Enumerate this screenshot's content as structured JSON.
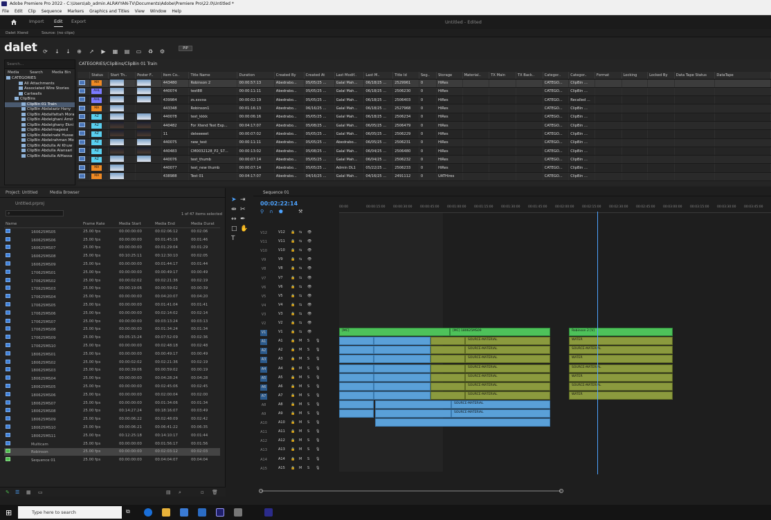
{
  "window": {
    "title": "Adobe Premiere Pro 2022 - C:\\Users\\ab_admin.ALRAYYAN-TV\\Documents\\Adobe\\Premiere Pro\\22.0\\Untitled *"
  },
  "menu": [
    "File",
    "Edit",
    "Clip",
    "Sequence",
    "Markers",
    "Graphics and Titles",
    "View",
    "Window",
    "Help"
  ],
  "workspace": {
    "tabs": [
      "Import",
      "Edit",
      "Export"
    ],
    "active": "Edit",
    "title": "Untitled - Edited"
  },
  "dalet": {
    "tabs": [
      "Dalet Xtend",
      "Source: (no clips)"
    ],
    "logo": "dalet",
    "toolbar_button": "PIP",
    "tree": {
      "search_placeholder": "Search...",
      "tabs": [
        "Media",
        "Search",
        "Media Bin"
      ],
      "items": [
        "CATEGORIES",
        "All Attachments",
        "Associated Wire Stories",
        "Cartwalls",
        "ClipBins",
        "ClipBin 01 Train",
        "ClipBin Abdalaziz Hany",
        "ClipBin Abdalfattah Mora",
        "ClipBin Abdelghani Amir",
        "ClipBin Abdelghany Ekni",
        "ClipBin Abdelmageed",
        "ClipBin Abdelnabi Husse",
        "ClipBin Abdelrahman Mo",
        "ClipBin Abdulla Al Khuw",
        "ClipBin Abdulla Alansari",
        "ClipBin Abdulla AlHassa"
      ]
    },
    "grid": {
      "path": "CATEGORIES/ClipBins/ClipBin 01 Train",
      "columns": [
        "",
        "Status",
        "Start Th..",
        "Poster F..",
        "Item Co..",
        "Title Name",
        "Duration",
        "Created By",
        "Created At",
        "Last Modif..",
        "Last M..",
        "Title Id",
        "Seg..",
        "Storage",
        "Material..",
        "TX Main",
        "TX Back..",
        "Categor..",
        "Categor..",
        "Format",
        "Locking",
        "Locked By",
        "Data Tape Status",
        "DataTape"
      ],
      "rows": [
        {
          "status": "MA",
          "id": "443480",
          "title": "Robinson 2",
          "dur": "00:00:57:13",
          "by": "Abedrabo...",
          "at": "05/05/25 ...",
          "mod": "Galal Mah...",
          "lm": "06/18/25 ...",
          "tid": "2529961",
          "seg": "0",
          "st": "HiRes",
          "c1": "CATEGO...",
          "c2": "ClipBin ..."
        },
        {
          "status": "AHL",
          "id": "440074",
          "title": "test88",
          "dur": "00:00:11:11",
          "by": "Abedrabo...",
          "at": "05/05/25 ...",
          "mod": "Galal Mah...",
          "lm": "06/18/25 ...",
          "tid": "2506230",
          "seg": "0",
          "st": "HiRes",
          "c1": "CATEGO...",
          "c2": "ClipBin ..."
        },
        {
          "status": "AHL",
          "id": "439984",
          "title": "zs.xxvxa",
          "dur": "00:00:02:19",
          "by": "Abedrabo...",
          "at": "05/05/25 ...",
          "mod": "Galal Mah...",
          "lm": "06/18/25 ...",
          "tid": "2506403",
          "seg": "0",
          "st": "HiRes",
          "c1": "CATEGO...",
          "c2": "Recalled ..."
        },
        {
          "status": "MA",
          "id": "443348",
          "title": "Robinson1",
          "dur": "00:01:16:13",
          "by": "Abedrabo...",
          "at": "06/16/25 ...",
          "mod": "Galal Mah...",
          "lm": "06/18/25 ...",
          "tid": "2527968",
          "seg": "0",
          "st": "HiRes",
          "c1": "CATEGO...",
          "c2": "ClipBin ..."
        },
        {
          "status": "AZ",
          "id": "440078",
          "title": "test_kkkk",
          "dur": "00:00:06:16",
          "by": "Abedrabo...",
          "at": "05/05/25 ...",
          "mod": "Galal Mah...",
          "lm": "06/18/25 ...",
          "tid": "2506234",
          "seg": "0",
          "st": "HiRes",
          "c1": "CATEGO...",
          "c2": "ClipBin ..."
        },
        {
          "status": "AZ",
          "id": "440482",
          "title": "For Xtend Test Exp...",
          "dur": "00:04:17:07",
          "by": "Abedrabo...",
          "at": "05/08/25 ...",
          "mod": "Galal Mah...",
          "lm": "06/05/25 ...",
          "tid": "2506479",
          "seg": "0",
          "st": "HiRes",
          "c1": "CATEGO...",
          "c2": "ClipBin ..."
        },
        {
          "status": "AZ",
          "id": "11",
          "title": "deleeeeet",
          "dur": "00:00:07:02",
          "by": "Abedrabo...",
          "at": "05/05/25 ...",
          "mod": "Galal Mah...",
          "lm": "06/05/25 ...",
          "tid": "2506229",
          "seg": "0",
          "st": "HiRes",
          "c1": "CATEGO...",
          "c2": "ClipBin ..."
        },
        {
          "status": "AZ",
          "id": "440075",
          "title": "new_test",
          "dur": "00:00:11:11",
          "by": "Abedrabo...",
          "at": "05/05/25 ...",
          "mod": "Abedrabo...",
          "lm": "06/05/25 ...",
          "tid": "2506231",
          "seg": "0",
          "st": "HiRes",
          "c1": "CATEGO...",
          "c2": "ClipBin ..."
        },
        {
          "status": "AZ",
          "id": "440483",
          "title": "CM0032128_P2_S7...",
          "dur": "00:00:13:02",
          "by": "Abedrabo...",
          "at": "05/08/25 ...",
          "mod": "Galal Mah...",
          "lm": "06/04/25 ...",
          "tid": "2506480",
          "seg": "0",
          "st": "HiRes",
          "c1": "CATEGO...",
          "c2": "ClipBin ..."
        },
        {
          "status": "AZ",
          "id": "440076",
          "title": "test_thumb",
          "dur": "00:00:07:14",
          "by": "Abedrabo...",
          "at": "05/05/25 ...",
          "mod": "Galal Mah...",
          "lm": "06/04/25 ...",
          "tid": "2506232",
          "seg": "0",
          "st": "HiRes",
          "c1": "CATEGO...",
          "c2": "ClipBin ..."
        },
        {
          "status": "MA",
          "id": "440077",
          "title": "test_new thumb",
          "dur": "00:00:07:14",
          "by": "Abedrabo...",
          "at": "05/05/25 ...",
          "mod": "Admin DL1",
          "lm": "05/22/25 ...",
          "tid": "2506233",
          "seg": "0",
          "st": "HiRes",
          "c1": "CATEGO...",
          "c2": "ClipBin ..."
        },
        {
          "status": "MA",
          "id": "438988",
          "title": "Test 01",
          "dur": "00:04:17:07",
          "by": "Abedrabo...",
          "at": "04/16/25 ...",
          "mod": "Galal Mah...",
          "lm": "04/16/25 ...",
          "tid": "2491112",
          "seg": "0",
          "st": "UATHires",
          "c1": "CATEGO...",
          "c2": "ClipBin ..."
        }
      ]
    }
  },
  "project": {
    "tabs": [
      "Project: Untitled",
      "Media Browser"
    ],
    "name": "Untitled.prproj",
    "count": "1 of 47 items selected",
    "columns": [
      "Name",
      "Frame Rate",
      "Media Start",
      "Media End",
      "Media Durat"
    ],
    "rows": [
      {
        "n": "160625MS05",
        "fr": "25.00 fps",
        "s": "00:00:00:00",
        "e": "00:02:06:12",
        "d": "00:02:06"
      },
      {
        "n": "160625MS06",
        "fr": "25.00 fps",
        "s": "00:00:00:00",
        "e": "00:01:45:16",
        "d": "00:01:46"
      },
      {
        "n": "160625MS07",
        "fr": "25.00 fps",
        "s": "00:00:00:00",
        "e": "00:01:29:04",
        "d": "00:01:29"
      },
      {
        "n": "160625MS08",
        "fr": "25.00 fps",
        "s": "00:10:25:11",
        "e": "00:12:30:10",
        "d": "00:02:05"
      },
      {
        "n": "160625MS09",
        "fr": "25.00 fps",
        "s": "00:00:00:00",
        "e": "00:01:44:17",
        "d": "00:01:44"
      },
      {
        "n": "170625MS01",
        "fr": "25.00 fps",
        "s": "00:00:00:00",
        "e": "00:00:49:17",
        "d": "00:00:49"
      },
      {
        "n": "170625MS02",
        "fr": "25.00 fps",
        "s": "00:00:02:02",
        "e": "00:02:21:36",
        "d": "00:02:19"
      },
      {
        "n": "170625MS03",
        "fr": "25.00 fps",
        "s": "00:00:19:06",
        "e": "00:00:59:02",
        "d": "00:00:39"
      },
      {
        "n": "170625MS04",
        "fr": "25.00 fps",
        "s": "00:00:00:00",
        "e": "00:04:20:07",
        "d": "00:04:20"
      },
      {
        "n": "170625MS05",
        "fr": "25.00 fps",
        "s": "00:00:00:00",
        "e": "00:01:41:04",
        "d": "00:01:41"
      },
      {
        "n": "170625MS06",
        "fr": "25.00 fps",
        "s": "00:00:00:00",
        "e": "00:02:14:02",
        "d": "00:02:14"
      },
      {
        "n": "170625MS07",
        "fr": "25.00 fps",
        "s": "00:00:00:00",
        "e": "00:03:13:24",
        "d": "00:03:13"
      },
      {
        "n": "170625MS08",
        "fr": "25.00 fps",
        "s": "00:00:00:00",
        "e": "00:01:34:24",
        "d": "00:01:34"
      },
      {
        "n": "170625MS09",
        "fr": "25.00 fps",
        "s": "00:05:15:24",
        "e": "00:07:52:09",
        "d": "00:02:36"
      },
      {
        "n": "170625MS10",
        "fr": "25.00 fps",
        "s": "00:00:00:00",
        "e": "00:02:48:18",
        "d": "00:02:48"
      },
      {
        "n": "180625MS01",
        "fr": "25.00 fps",
        "s": "00:00:00:00",
        "e": "00:00:49:17",
        "d": "00:00:49"
      },
      {
        "n": "180625MS02",
        "fr": "25.00 fps",
        "s": "00:00:02:02",
        "e": "00:02:21:36",
        "d": "00:02:19"
      },
      {
        "n": "180625MS03",
        "fr": "25.00 fps",
        "s": "00:00:39:06",
        "e": "00:00:59:02",
        "d": "00:00:19"
      },
      {
        "n": "180625MS04",
        "fr": "25.00 fps",
        "s": "00:00:00:00",
        "e": "00:04:28:24",
        "d": "00:04:28"
      },
      {
        "n": "180625MS05",
        "fr": "25.00 fps",
        "s": "00:00:00:00",
        "e": "00:02:45:06",
        "d": "00:02:45"
      },
      {
        "n": "180625MS06",
        "fr": "25.00 fps",
        "s": "00:00:00:00",
        "e": "00:02:00:04",
        "d": "00:02:00"
      },
      {
        "n": "180625MS07",
        "fr": "25.00 fps",
        "s": "00:00:00:00",
        "e": "00:01:34:06",
        "d": "00:01:34"
      },
      {
        "n": "180625MS08",
        "fr": "25.00 fps",
        "s": "00:14:27:24",
        "e": "00:18:16:07",
        "d": "00:03:49"
      },
      {
        "n": "180625MS09",
        "fr": "25.00 fps",
        "s": "00:00:06:22",
        "e": "00:02:48:09",
        "d": "00:02:42"
      },
      {
        "n": "180625MS10",
        "fr": "25.00 fps",
        "s": "00:00:06:21",
        "e": "00:06:41:22",
        "d": "00:06:35"
      },
      {
        "n": "180625MS11",
        "fr": "25.00 fps",
        "s": "00:12:25:18",
        "e": "00:14:10:17",
        "d": "00:01:44"
      },
      {
        "n": "Multicam",
        "fr": "25.00 fps",
        "s": "00:00:00:00",
        "e": "00:01:56:17",
        "d": "00:01:56"
      },
      {
        "n": "Robinson",
        "fr": "25.00 fps",
        "s": "00:00:00:00",
        "e": "00:02:03:12",
        "d": "00:02:03"
      },
      {
        "n": "Sequence 01",
        "fr": "25.00 fps",
        "s": "00:00:00:00",
        "e": "00:04:04:07",
        "d": "00:04:04"
      }
    ]
  },
  "sequence": {
    "tab": "Sequence 01",
    "timecode": "00:02:22:14",
    "ruler": [
      "00:00",
      "00:00:15:00",
      "00:00:30:00",
      "00:00:45:00",
      "00:01:00:00",
      "00:01:15:00",
      "00:01:30:00",
      "00:01:45:00",
      "00:02:00:00",
      "00:02:15:00",
      "00:02:30:00",
      "00:02:45:00",
      "00:03:00:00",
      "00:03:15:00",
      "00:03:30:00",
      "00:03:45:00",
      "00:04:00:00"
    ],
    "video_tracks": [
      "V12",
      "V11",
      "V10",
      "V9",
      "V8",
      "V7",
      "V6",
      "V5",
      "V4",
      "V3",
      "V2",
      "V1"
    ],
    "audio_tracks": [
      "A1",
      "A2",
      "A3",
      "A4",
      "A5",
      "A6",
      "A7",
      "A8",
      "A9",
      "A10",
      "A11",
      "A12",
      "A13",
      "A14",
      "A15"
    ],
    "clip_labels": {
      "v1a": "[MC]",
      "v1b": "[MC] 180625MS09",
      "v1c": "Robinson 2 [V]",
      "audio": "SOURCE-MATERIAL",
      "water": "WATER",
      "sourc": "SOURC"
    }
  },
  "taskbar": {
    "search_placeholder": "Type here to search"
  }
}
